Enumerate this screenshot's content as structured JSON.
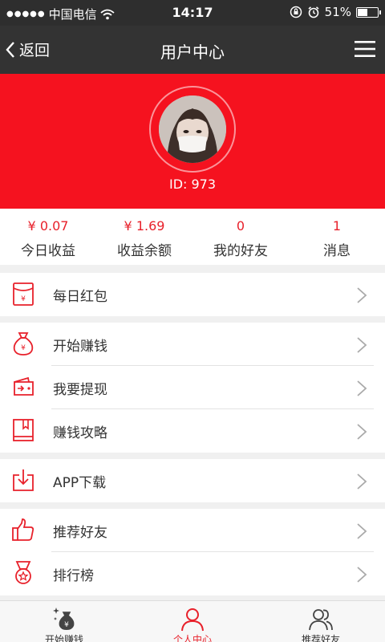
{
  "status_bar": {
    "signal_dots": "●●●●●",
    "carrier": "中国电信",
    "time": "14:17",
    "battery_text": "51%",
    "battery_level": 0.51
  },
  "nav": {
    "back_label": "返回",
    "title": "用户中心"
  },
  "profile": {
    "id_text": "ID: 973"
  },
  "stats": [
    {
      "value": "¥ 0.07",
      "label": "今日收益"
    },
    {
      "value": "¥ 1.69",
      "label": "收益余额"
    },
    {
      "value": "0",
      "label": "我的好友"
    },
    {
      "value": "1",
      "label": "消息"
    }
  ],
  "menu": {
    "group1": [
      {
        "label": "每日红包",
        "icon": "red-envelope-icon"
      }
    ],
    "group2": [
      {
        "label": "开始赚钱",
        "icon": "money-bag-icon"
      },
      {
        "label": "我要提现",
        "icon": "wallet-icon"
      },
      {
        "label": "赚钱攻略",
        "icon": "guide-book-icon"
      }
    ],
    "group3": [
      {
        "label": "APP下载",
        "icon": "download-icon"
      }
    ],
    "group4": [
      {
        "label": "推荐好友",
        "icon": "thumbs-up-icon"
      },
      {
        "label": "排行榜",
        "icon": "medal-icon"
      }
    ]
  },
  "tabs": [
    {
      "label": "开始赚钱",
      "icon": "money-bag-sparkle-icon",
      "active": false
    },
    {
      "label": "个人中心",
      "icon": "person-icon",
      "active": true
    },
    {
      "label": "推荐好友",
      "icon": "friends-icon",
      "active": false
    }
  ],
  "colors": {
    "accent": "#f5121f",
    "icon_red": "#e8212b",
    "nav_bg": "#333333"
  }
}
